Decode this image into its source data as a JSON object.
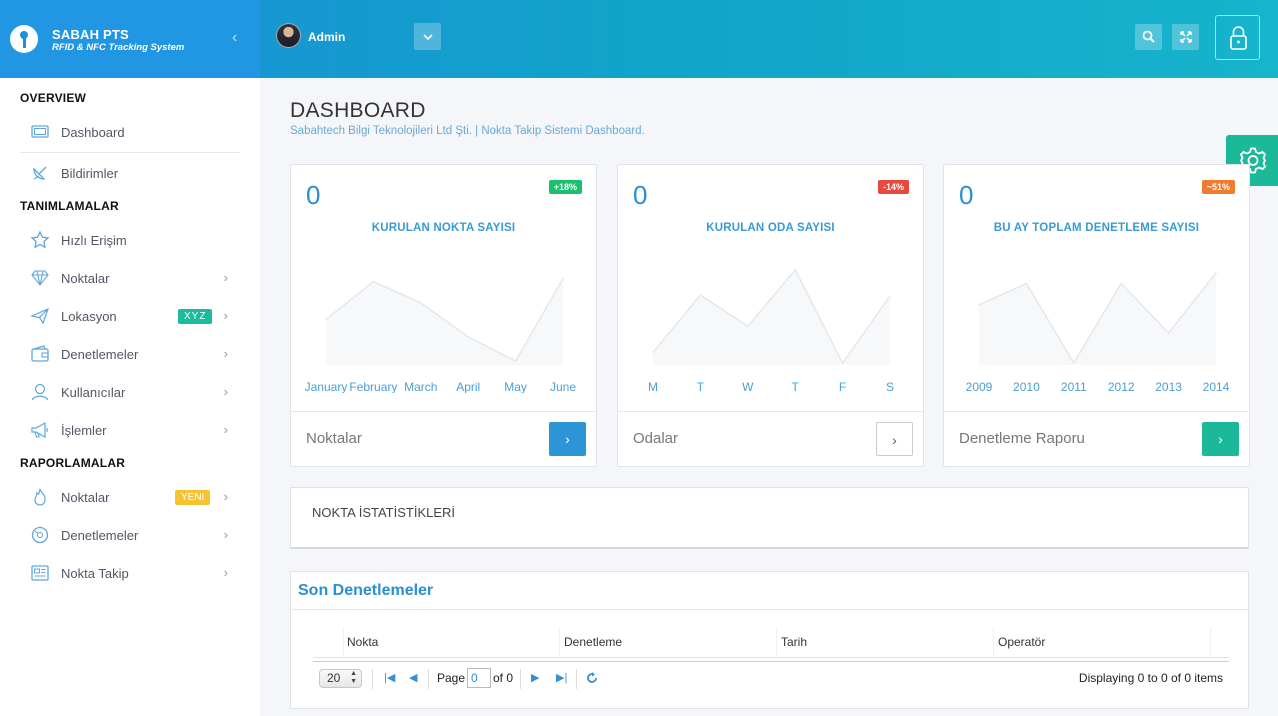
{
  "brand": {
    "title": "SABAH PTS",
    "subtitle": "RFID & NFC Tracking System"
  },
  "header": {
    "user_name": "Admin"
  },
  "sidebar": {
    "sections": [
      {
        "title": "OVERVIEW"
      },
      {
        "title": "TANIMLAMALAR"
      },
      {
        "title": "RAPORLAMALAR"
      }
    ],
    "items": [
      {
        "label": "Dashboard"
      },
      {
        "label": "Bildirimler"
      },
      {
        "label": "Hızlı Erişim"
      },
      {
        "label": "Noktalar"
      },
      {
        "label": "Lokasyon",
        "badge": "XYZ"
      },
      {
        "label": "Denetlemeler"
      },
      {
        "label": "Kullanıcılar"
      },
      {
        "label": "İşlemler"
      },
      {
        "label": "Noktalar",
        "badge": "YENI"
      },
      {
        "label": "Denetlemeler"
      },
      {
        "label": "Nokta Takip"
      }
    ]
  },
  "page": {
    "title": "DASHBOARD",
    "subtitle": "Sabahtech Bilgi Teknolojileri Ltd Şti. | Nokta Takip Sistemi Dashboard."
  },
  "cards": [
    {
      "value": "0",
      "badge": "+18%",
      "badge_color": "#1bc06e",
      "title": "KURULAN NOKTA SAYISI",
      "link": "Noktalar",
      "button_color": "#2b95d6"
    },
    {
      "value": "0",
      "badge": "-14%",
      "badge_color": "#e8493f",
      "title": "KURULAN ODA SAYISI",
      "link": "Odalar",
      "button_color": "#ffffff"
    },
    {
      "value": "0",
      "badge": "~51%",
      "badge_color": "#ef7c2e",
      "title": "BU AY TOPLAM DENETLEME SAYISI",
      "link": "Denetleme Raporu",
      "button_color": "#1bb99a"
    }
  ],
  "chart_data": [
    {
      "type": "line",
      "categories": [
        "January",
        "February",
        "March",
        "April",
        "May",
        "June"
      ],
      "values": [
        47,
        86,
        64,
        29,
        4,
        89
      ],
      "ylim": [
        0,
        100
      ],
      "grid": false
    },
    {
      "type": "line",
      "categories": [
        "M",
        "T",
        "W",
        "T",
        "F",
        "S"
      ],
      "values": [
        13,
        72,
        40,
        98,
        2,
        71
      ],
      "ylim": [
        0,
        100
      ],
      "grid": false
    },
    {
      "type": "line",
      "categories": [
        "2009",
        "2010",
        "2011",
        "2012",
        "2013",
        "2014"
      ],
      "values": [
        62,
        84,
        2,
        84,
        33,
        95
      ],
      "ylim": [
        0,
        100
      ],
      "grid": false
    }
  ],
  "stats_panel": {
    "title": "NOKTA İSTATİSTİKLERİ"
  },
  "table": {
    "title": "Son Denetlemeler",
    "columns": [
      "Nokta",
      "Denetleme",
      "Tarih",
      "Operatör"
    ],
    "page_size": "20",
    "page_label": "Page",
    "page_value": "0",
    "of_label": "of 0",
    "display_text": "Displaying 0 to 0 of 0 items"
  }
}
